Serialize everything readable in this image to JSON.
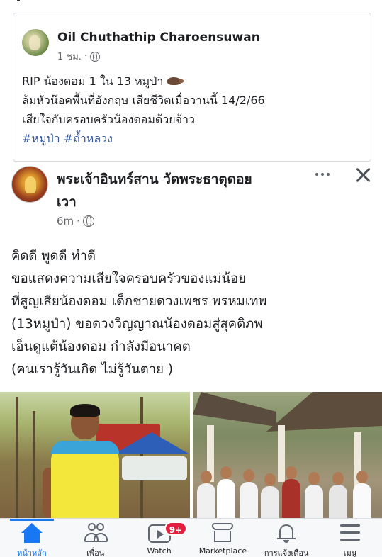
{
  "shared_post": {
    "author": "Oil Chuthathip Charoensuwan",
    "time": "1 ชม.",
    "separator": "·",
    "lines": [
      "RIP น้องดอม 1 ใน 13 หมูป่า",
      "ล้มหัวน๊อคพื้นที่อังกฤษ เสียชีวิตเมื่อวานนี้ 14/2/66",
      "เสียใจกับครอบครัวน้องดอมด้วยจ้าว"
    ],
    "hashtags": "#หมูป่า #ถ้ำหลวง",
    "emoji_icon": "boar-icon"
  },
  "post": {
    "author": "พระเจ้าอินทร์สาน วัดพระธาตุดอยเวา",
    "author_line1": "พระเจ้าอินทร์สาน วัดพระธาตุดอย",
    "author_line2": "เวา",
    "time": "6m",
    "separator": "·",
    "body_lines": [
      "คิดดี พูดดี ทำดี",
      "ขอแสดงความเสียใจครอบครัวของแม่น้อย",
      "ที่สูญเสียน้องดอม  เด็กชายดวงเพชร พรหมเทพ",
      "(13หมูป่า) ขอดวงวิญญาณน้องดอมสู่สุคติภพ",
      "เอ็นดูแต้น้องดอม กำลังมีอนาคต",
      "(คนเรารู้วันเกิด ไม่รู้วันตาย )"
    ]
  },
  "bottom_nav": {
    "items": [
      {
        "label": "หน้าหลัก",
        "icon": "home-icon",
        "active": true
      },
      {
        "label": "เพื่อน",
        "icon": "friends-icon",
        "active": false
      },
      {
        "label": "Watch",
        "icon": "watch-icon",
        "active": false,
        "badge": "9+"
      },
      {
        "label": "Marketplace",
        "icon": "marketplace-icon",
        "active": false
      },
      {
        "label": "การแจ้งเตือน",
        "icon": "bell-icon",
        "active": false
      },
      {
        "label": "เมนู",
        "icon": "menu-icon",
        "active": false
      }
    ]
  },
  "colors": {
    "accent": "#1877f2",
    "hashtag": "#385898",
    "badge": "#e41e3f",
    "meta_text": "#65676b"
  }
}
